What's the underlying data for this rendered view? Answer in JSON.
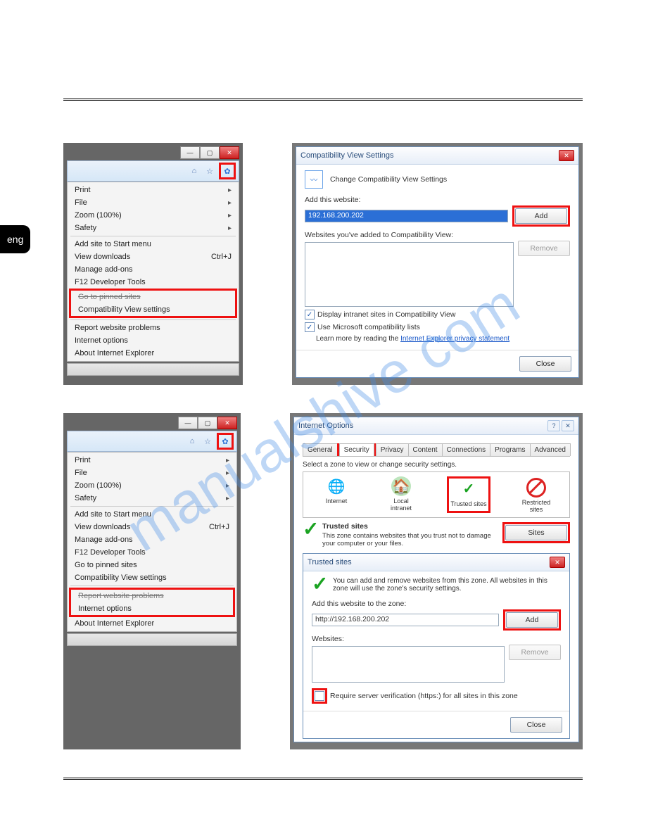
{
  "lang_tab": "eng",
  "watermark": "manualshive com",
  "ie_menu": {
    "items_top": [
      {
        "label": "Print",
        "arrow": true
      },
      {
        "label": "File",
        "arrow": true
      },
      {
        "label": "Zoom (100%)",
        "arrow": true
      },
      {
        "label": "Safety",
        "arrow": true
      }
    ],
    "items_mid": [
      {
        "label": "Add site to Start menu"
      },
      {
        "label": "View downloads",
        "shortcut": "Ctrl+J"
      },
      {
        "label": "Manage add-ons"
      },
      {
        "label": "F12 Developer Tools"
      },
      {
        "label": "Go to pinned sites"
      }
    ],
    "compat_item": "Compatibility View settings",
    "items_bottom": [
      {
        "label": "Report website problems"
      },
      {
        "label": "Internet options"
      },
      {
        "label": "About Internet Explorer"
      }
    ]
  },
  "compat_dialog": {
    "title": "Compatibility View Settings",
    "header": "Change Compatibility View Settings",
    "add_label": "Add this website:",
    "add_value": "192.168.200.202",
    "add_btn": "Add",
    "list_label": "Websites you've added to Compatibility View:",
    "remove_btn": "Remove",
    "cb1": "Display intranet sites in Compatibility View",
    "cb2": "Use Microsoft compatibility lists",
    "learn_prefix": "Learn more by reading the ",
    "learn_link": "Internet Explorer privacy statement",
    "close_btn": "Close"
  },
  "inet_opts": {
    "title": "Internet Options",
    "tabs": [
      "General",
      "Security",
      "Privacy",
      "Content",
      "Connections",
      "Programs",
      "Advanced"
    ],
    "select_zone_label": "Select a zone to view or change security settings.",
    "zones": [
      "Internet",
      "Local intranet",
      "Trusted sites",
      "Restricted sites"
    ],
    "trusted_heading": "Trusted sites",
    "trusted_desc": "This zone contains websites that you trust not to damage your computer or your files.",
    "sites_btn": "Sites"
  },
  "trusted_dialog": {
    "title": "Trusted sites",
    "desc": "You can add and remove websites from this zone. All websites in this zone will use the zone's security settings.",
    "add_label": "Add this website to the zone:",
    "add_value": "http://192.168.200.202",
    "add_btn": "Add",
    "websites_label": "Websites:",
    "remove_btn": "Remove",
    "require_https": "Require server verification (https:) for all sites in this zone",
    "close_btn": "Close"
  }
}
